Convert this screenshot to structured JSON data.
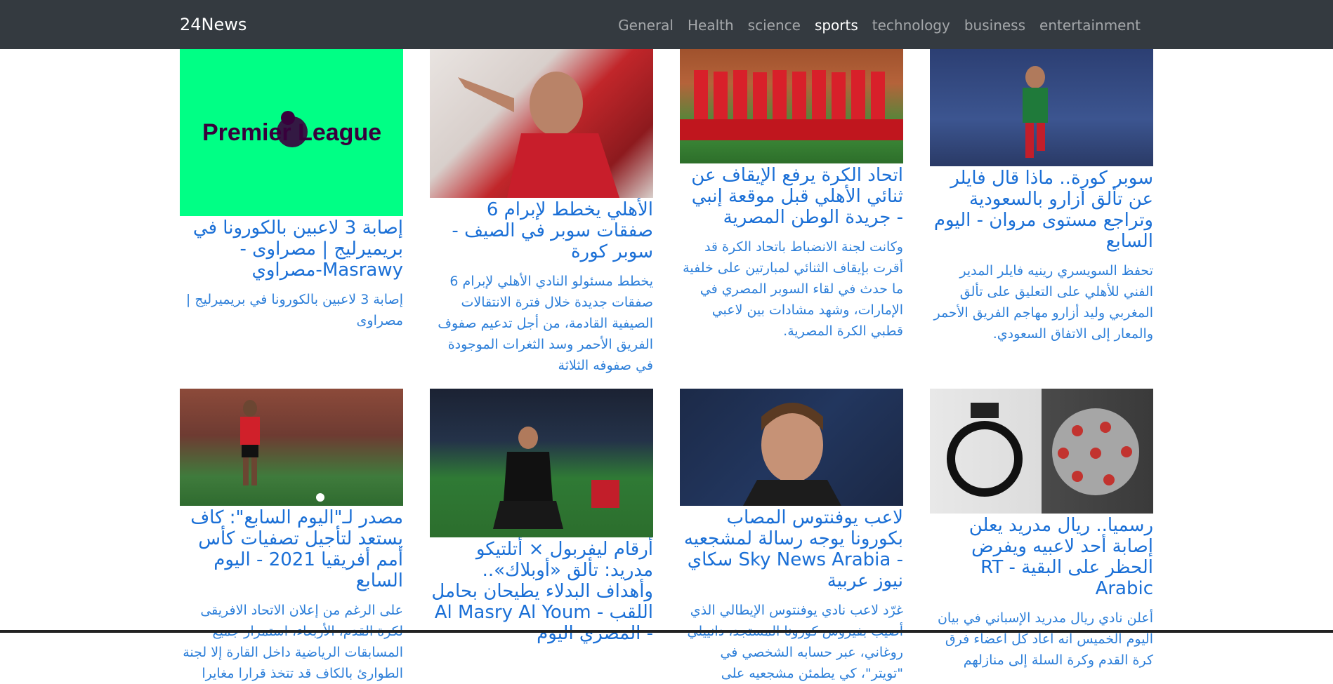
{
  "navbar": {
    "brand": "24News",
    "links": [
      "General",
      "Health",
      "science",
      "sports",
      "technology",
      "business",
      "entertainment"
    ],
    "active": "sports"
  },
  "articles": [
    {
      "image": "premier-league-logo",
      "logo_text": "Premier League",
      "title": "إصابة 3 لاعبين بالكورونا في بريميرليج | مصراوى - Masrawy-مصراوي",
      "description": "إصابة 3 لاعبين بالكورونا في بريميرليج | مصراوى"
    },
    {
      "image": "ahly-player-celebrating-photo",
      "title": "الأهلي يخطط لإبرام 6 صفقات سوبر في الصيف - سوبر كورة",
      "description": "يخطط مسئولو النادي الأهلي لإبرام 6 صفقات جديدة خلال فترة الانتقالات الصيفية القادمة، من أجل تدعيم صفوف الفريق الأحمر وسد الثغرات الموجودة في صفوفه الثلاثة"
    },
    {
      "image": "ahly-team-lineup-photo",
      "title": "اتحاد الكرة يرفع الإيقاف عن ثنائي الأهلي قبل موقعة إنبي - جريدة الوطن المصرية",
      "description": "وكانت لجنة الانضباط باتحاد الكرة قد أقرت بإيقاف الثنائي لمبارتين على خلفية ما حدث في لقاء السوبر المصري في الإمارات، وشهد مشادات بين لاعبي قطبي الكرة المصرية."
    },
    {
      "image": "player-kicking-ball-photo",
      "title": "سوبر كورة.. ماذا قال فايلر عن تألق أزارو بالسعودية وتراجع مستوى مروان - اليوم السابع",
      "description": "تحفظ السويسري رينيه فايلر المدير الفني للأهلي على التعليق على تألق المغربي وليد أزارو مهاجم الفريق الأحمر والمعار إلى الاتفاق السعودي."
    },
    {
      "image": "salah-egypt-player-photo",
      "title": "مصدر لـ\"اليوم السابع\": كاف يستعد لتأجيل تصفيات كأس أمم أفريقيا 2021 - اليوم السابع",
      "description": "على الرغم من إعلان الاتحاد الافريقى لكرة القدم، الأربعاء، استمرار جميع المسابقات الرياضية داخل القارة إلا لجنة الطوارئ بالكاف قد تتخذ قرارا مغايرا"
    },
    {
      "image": "morata-kneeling-photo",
      "title": "أرقام ليفربول × أتلتيكو مدريد: تألق «أوبلاك».. وأهداف البدلاء يطيحان بحامل اللقب - Al Masry Al Youm - المصري اليوم",
      "description": ""
    },
    {
      "image": "rugani-press-photo",
      "title": "لاعب يوفنتوس المصاب بكورونا يوجه رسالة لمشجعيه - Sky News Arabia سكاي نيوز عربية",
      "description": "غرّد لاعب نادي يوفنتوس الإيطالي الذي أصيب بفيروس كورونا المستجد، دانييلي روغاني، عبر حسابه الشخصي في \"تويتر\"، كي يطمئن مشجعيه على"
    },
    {
      "image": "real-madrid-crest-and-virus-photo",
      "title": "رسميا.. ريال مدريد يعلن إصابة أحد لاعبيه ويفرض الحظر على البقية - RT Arabic",
      "description": "أعلن نادي ريال مدريد الإسباني في بيان اليوم الخميس أنه أعاد كل أعضاء فرق كرة القدم وكرة السلة إلى منازلهم"
    }
  ]
}
